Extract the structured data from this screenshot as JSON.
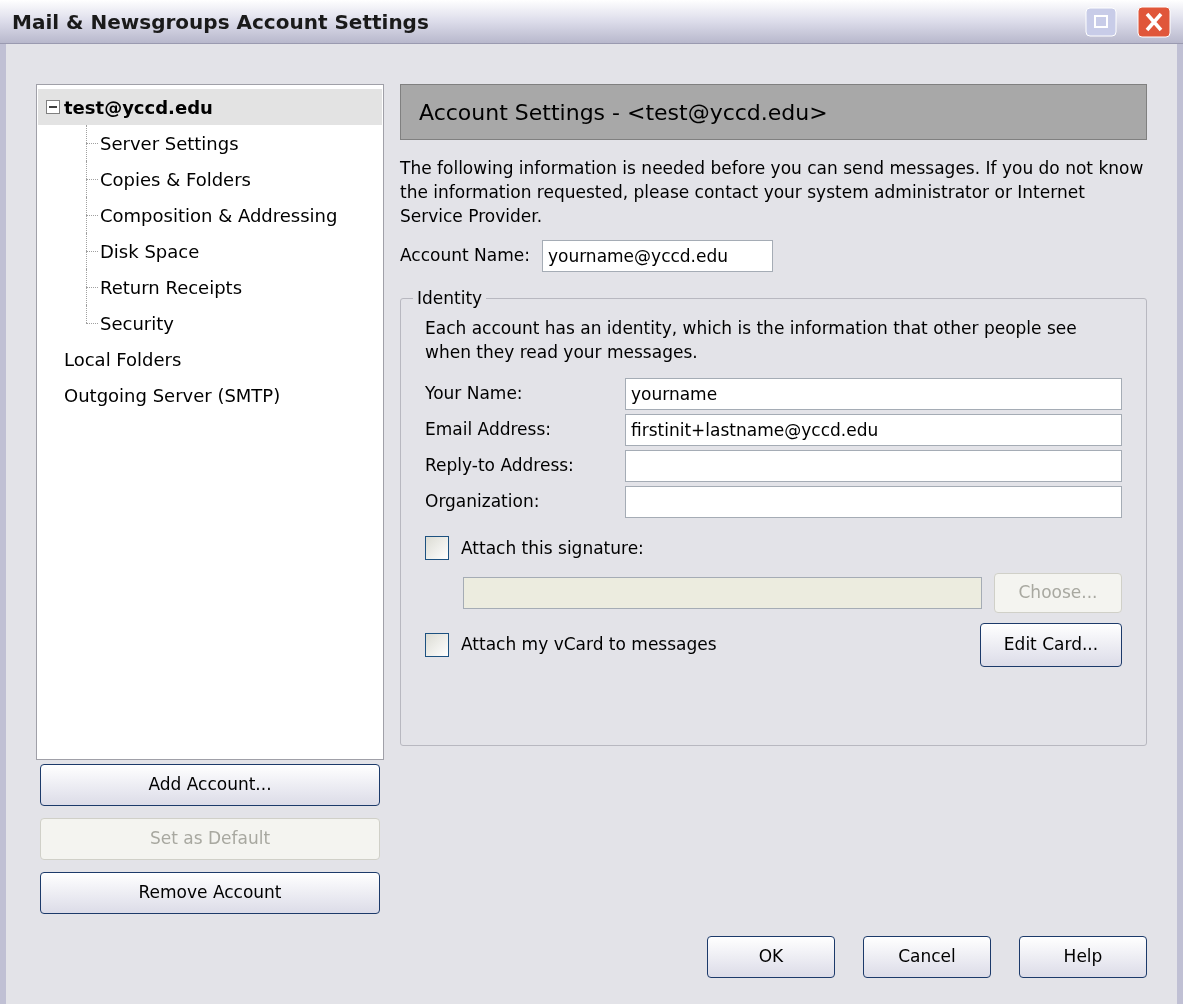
{
  "window": {
    "title": "Mail & Newsgroups Account Settings"
  },
  "tree": [
    {
      "label": "test@yccd.edu",
      "selected": true,
      "expanded": true,
      "children": [
        {
          "label": "Server Settings",
          "selected": false
        },
        {
          "label": "Copies & Folders",
          "selected": false
        },
        {
          "label": "Composition & Addressing",
          "selected": false
        },
        {
          "label": "Disk Space",
          "selected": false
        },
        {
          "label": "Return Receipts",
          "selected": false
        },
        {
          "label": "Security",
          "selected": false
        }
      ]
    },
    {
      "label": "Local Folders",
      "selected": false
    },
    {
      "label": "Outgoing Server (SMTP)",
      "selected": false
    }
  ],
  "account_buttons": [
    {
      "label": "Add Account...",
      "disabled": false
    },
    {
      "label": "Set as Default",
      "disabled": true
    },
    {
      "label": "Remove Account",
      "disabled": false
    }
  ],
  "header": {
    "title": "Account Settings - <test@yccd.edu>"
  },
  "intro": "The following information is needed before you can send messages. If you do not know the information requested, please contact your system administrator or Internet Service Provider.",
  "account_name": {
    "label": "Account Name:",
    "value": "yourname@yccd.edu"
  },
  "identity": {
    "legend": "Identity",
    "description": "Each account has an identity, which is the information that other people see when they read your messages.",
    "fields": [
      {
        "label": "Your Name:",
        "value": "yourname"
      },
      {
        "label": "Email Address:",
        "value": "firstinit+lastname@yccd.edu"
      },
      {
        "label": "Reply-to Address:"
      },
      {
        "label": "Organization:"
      }
    ],
    "signature": {
      "label": "Attach this signature:",
      "checked": false
    },
    "signature_file": {
      "disabled": true
    },
    "choose_button": {
      "label": "Choose...",
      "disabled": true
    },
    "vcard": {
      "label": "Attach my vCard to messages",
      "checked": false
    },
    "edit_card_button": {
      "label": "Edit Card...",
      "disabled": false
    }
  },
  "dialog_buttons": [
    {
      "label": "OK"
    },
    {
      "label": "Cancel"
    },
    {
      "label": "Help"
    }
  ]
}
